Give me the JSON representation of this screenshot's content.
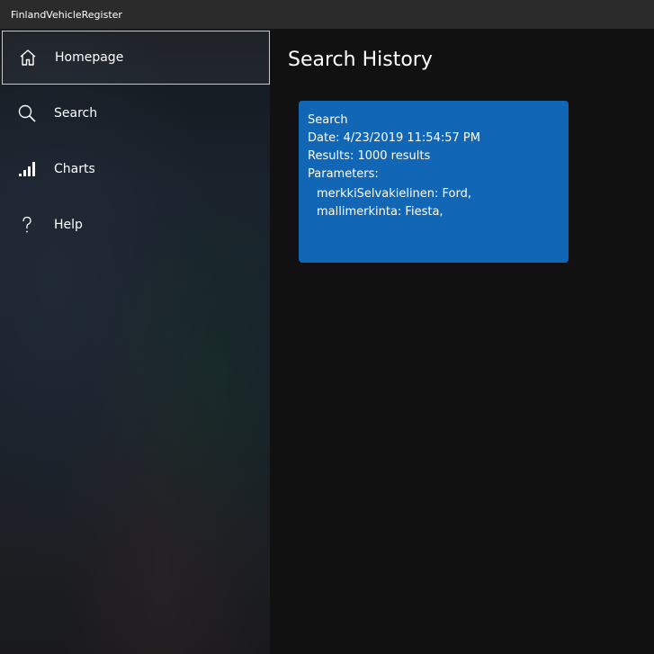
{
  "window": {
    "title": "FinlandVehicleRegister"
  },
  "sidebar": {
    "items": [
      {
        "label": "Homepage",
        "icon": "home-icon",
        "selected": true
      },
      {
        "label": "Search",
        "icon": "search-icon",
        "selected": false
      },
      {
        "label": "Charts",
        "icon": "chart-icon",
        "selected": false
      },
      {
        "label": "Help",
        "icon": "help-icon",
        "selected": false
      }
    ]
  },
  "main": {
    "title": "Search History",
    "history": [
      {
        "heading": "Search",
        "date": "Date: 4/23/2019 11:54:57 PM",
        "results": "Results: 1000 results",
        "parameters_label": "Parameters:",
        "parameters": [
          "merkkiSelvakielinen: Ford,",
          "mallimerkinta: Fiesta,"
        ]
      }
    ]
  },
  "colors": {
    "titlebar": "#2b2b2b",
    "background": "#111111",
    "card": "#1166b5",
    "selected_border": "#c8c8c8"
  }
}
